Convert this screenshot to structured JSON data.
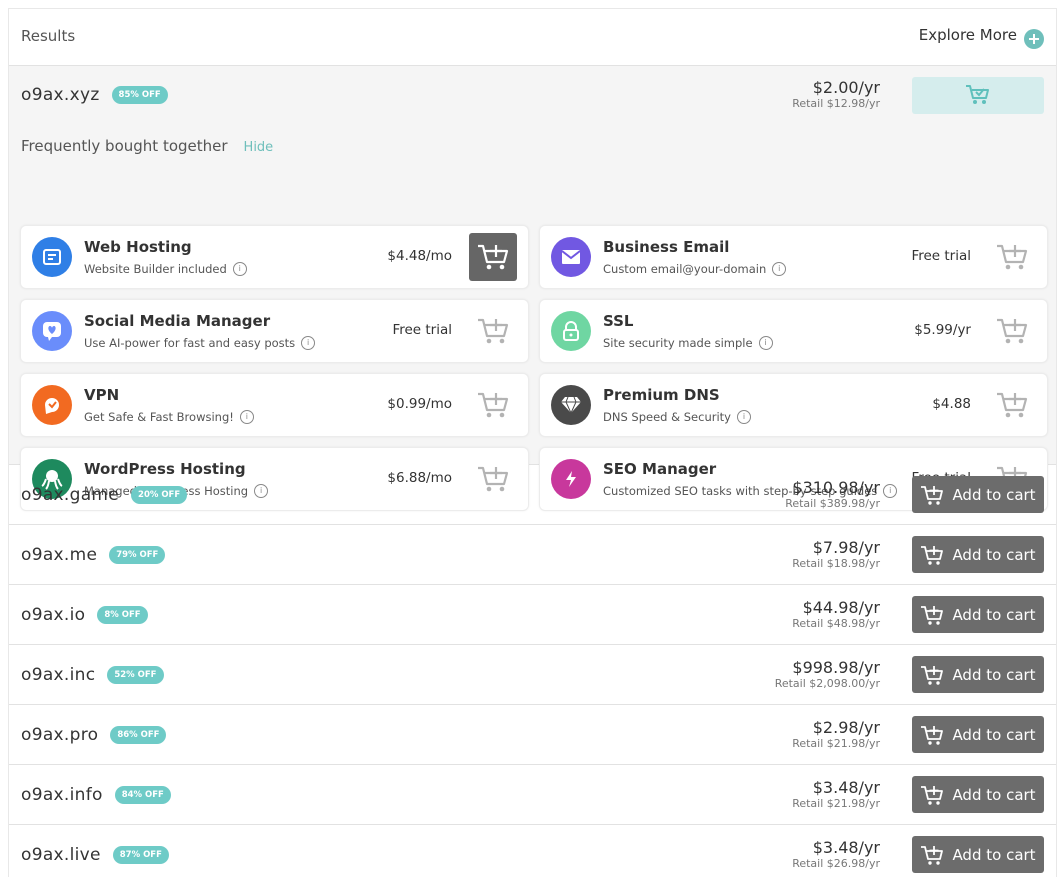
{
  "header": {
    "results_label": "Results",
    "explore_label": "Explore More"
  },
  "featured": {
    "domain": "o9ax.xyz",
    "badge": "85% OFF",
    "price": "$2.00/yr",
    "retail": "Retail $12.98/yr",
    "fbt_title": "Frequently bought together",
    "fbt_hide": "Hide"
  },
  "products": [
    {
      "title": "Web Hosting",
      "sub": "Website Builder included",
      "price": "$4.48/mo",
      "icon": "web-hosting-icon",
      "color": "#2f7fe6"
    },
    {
      "title": "Business Email",
      "sub": "Custom email@your-domain",
      "price": "Free trial",
      "icon": "mail-icon",
      "color": "#7158e2"
    },
    {
      "title": "Social Media Manager",
      "sub": "Use AI-power for fast and easy posts",
      "price": "Free trial",
      "icon": "heart-chat-icon",
      "color": "#6a8dfb"
    },
    {
      "title": "SSL",
      "sub": "Site security made simple",
      "price": "$5.99/yr",
      "icon": "lock-icon",
      "color": "#6fd6a2"
    },
    {
      "title": "VPN",
      "sub": "Get Safe & Fast Browsing!",
      "price": "$0.99/mo",
      "icon": "vpn-icon",
      "color": "#f26a21"
    },
    {
      "title": "Premium DNS",
      "sub": "DNS Speed & Security",
      "price": "$4.88",
      "icon": "diamond-icon",
      "color": "#4a4a4a"
    },
    {
      "title": "WordPress Hosting",
      "sub": "Managed WordPress Hosting",
      "price": "$6.88/mo",
      "icon": "octopus-icon",
      "color": "#1e8a5e"
    },
    {
      "title": "SEO Manager",
      "sub": "Customized SEO tasks with step-by-step guides",
      "price": "Free trial",
      "icon": "lightning-icon",
      "color": "#c8389c"
    }
  ],
  "add_label": "Add to cart",
  "domains": [
    {
      "name": "o9ax.game",
      "badge": "20% OFF",
      "price": "$310.98/yr",
      "retail": "Retail $389.98/yr"
    },
    {
      "name": "o9ax.me",
      "badge": "79% OFF",
      "price": "$7.98/yr",
      "retail": "Retail $18.98/yr"
    },
    {
      "name": "o9ax.io",
      "badge": "8% OFF",
      "price": "$44.98/yr",
      "retail": "Retail $48.98/yr"
    },
    {
      "name": "o9ax.inc",
      "badge": "52% OFF",
      "price": "$998.98/yr",
      "retail": "Retail $2,098.00/yr"
    },
    {
      "name": "o9ax.pro",
      "badge": "86% OFF",
      "price": "$2.98/yr",
      "retail": "Retail $21.98/yr"
    },
    {
      "name": "o9ax.info",
      "badge": "84% OFF",
      "price": "$3.48/yr",
      "retail": "Retail $21.98/yr"
    },
    {
      "name": "o9ax.live",
      "badge": "87% OFF",
      "price": "$3.48/yr",
      "retail": "Retail $26.98/yr"
    }
  ]
}
